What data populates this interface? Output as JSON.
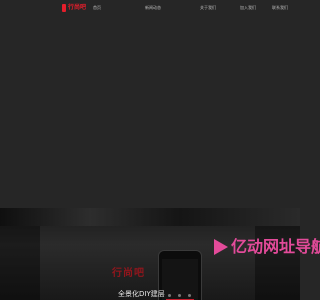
{
  "nav": {
    "logo_text": "行尚吧",
    "items": [
      {
        "label": "首页"
      },
      {
        "label": "新闻动态"
      },
      {
        "label": "关于我们"
      },
      {
        "label": "加入我们"
      },
      {
        "label": "联系我们"
      }
    ]
  },
  "hero": {
    "red_text": "行尚吧",
    "subtitle": "全景化DIY建层"
  },
  "watermark": {
    "text": "亿动网址导航"
  },
  "colors": {
    "background": "#262626",
    "brand_red": "#e41e2b",
    "watermark_pink": "#e34b9a"
  }
}
